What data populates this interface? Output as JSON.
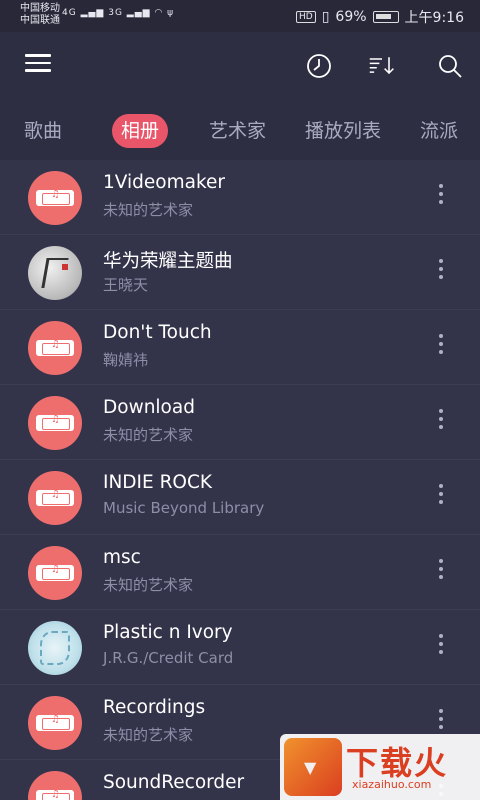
{
  "status_bar": {
    "carrier_1": "中国移动",
    "carrier_2": "中国联通",
    "signal_1": "4G",
    "signal_2": "3G",
    "hd": "HD",
    "battery": "69%",
    "time": "上午9:16"
  },
  "toolbar": {
    "menu_icon": "menu-icon",
    "clock_icon": "clock-icon",
    "sort_icon": "sort-icon",
    "search_icon": "search-icon"
  },
  "tabs": [
    {
      "label": "歌曲",
      "active": false
    },
    {
      "label": "相册",
      "active": true
    },
    {
      "label": "艺术家",
      "active": false
    },
    {
      "label": "播放列表",
      "active": false
    },
    {
      "label": "流派",
      "active": false
    }
  ],
  "albums": [
    {
      "title": "1Videomaker",
      "artist": "未知的艺术家",
      "art": "default"
    },
    {
      "title": "华为荣耀主题曲",
      "artist": "王晓天",
      "art": "gray"
    },
    {
      "title": "Don't Touch",
      "artist": "鞠婧祎",
      "art": "default"
    },
    {
      "title": "Download",
      "artist": "未知的艺术家",
      "art": "default"
    },
    {
      "title": "INDIE ROCK",
      "artist": "Music Beyond Library",
      "art": "default"
    },
    {
      "title": "msc",
      "artist": "未知的艺术家",
      "art": "default"
    },
    {
      "title": "Plastic n Ivory",
      "artist": "J.R.G./Credit Card",
      "art": "blue"
    },
    {
      "title": "Recordings",
      "artist": "未知的艺术家",
      "art": "default"
    },
    {
      "title": "SoundRecorder",
      "artist": "",
      "art": "default"
    }
  ],
  "watermark": {
    "text": "下载火",
    "url": "xiazaihuo.com"
  },
  "colors": {
    "accent": "#e9566a",
    "background": "#2e2e42",
    "list_bg": "#33334a"
  }
}
